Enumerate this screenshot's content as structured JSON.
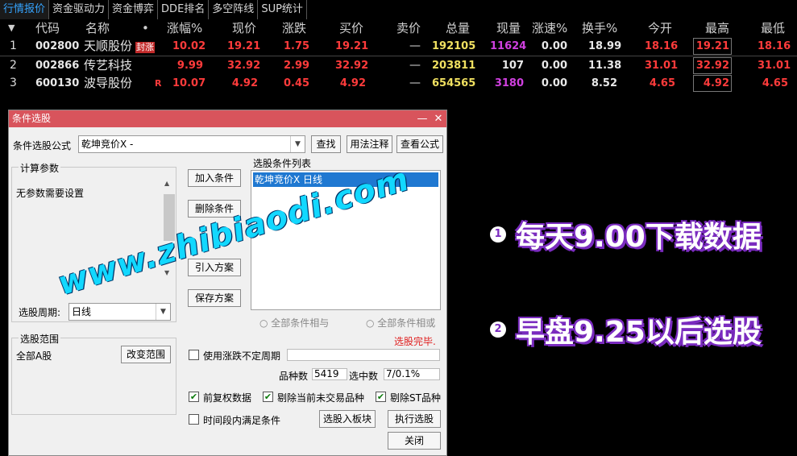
{
  "tabs": [
    "行情报价",
    "资金驱动力",
    "资金博弈",
    "DDE排名",
    "多空阵线",
    "SUP统计"
  ],
  "header": {
    "sort_icon": "▼",
    "cols": [
      "代码",
      "名称",
      "•",
      "涨幅%",
      "现价",
      "涨跌",
      "买价",
      "卖价",
      "总量",
      "现量",
      "涨速%",
      "换手%",
      "今开",
      "最高",
      "最低"
    ]
  },
  "rows": [
    {
      "idx": "1",
      "code": "002800",
      "name": "天顺股份",
      "tag": "封涨",
      "pct": "10.02",
      "price": "19.21",
      "chg": "1.75",
      "bid": "19.21",
      "ask": "—",
      "vol": "192105",
      "cur": "11624",
      "spd": "0.00",
      "turn": "18.99",
      "open": "18.16",
      "high": "19.21",
      "low": "18.16"
    },
    {
      "idx": "2",
      "code": "002866",
      "name": "传艺科技",
      "tag": "",
      "pct": "9.99",
      "price": "32.92",
      "chg": "2.99",
      "bid": "32.92",
      "ask": "—",
      "vol": "203811",
      "cur": "107",
      "spd": "0.00",
      "turn": "11.38",
      "open": "31.01",
      "high": "32.92",
      "low": "31.01"
    },
    {
      "idx": "3",
      "code": "600130",
      "name": "波导股份",
      "tag": "R",
      "pct": "10.07",
      "price": "4.92",
      "chg": "0.45",
      "bid": "4.92",
      "ask": "—",
      "vol": "654565",
      "cur": "3180",
      "spd": "0.00",
      "turn": "8.52",
      "open": "4.65",
      "high": "4.92",
      "low": "4.65"
    }
  ],
  "colors": {
    "up": "#ff3b3b",
    "yellow": "#f0e060",
    "purple": "#d040e0",
    "white": "#e8e8e8",
    "cyan": "#12d8ff"
  },
  "dialog": {
    "title": "条件选股",
    "minimize": "—",
    "close": "✕",
    "formula_label": "条件选股公式",
    "formula_value": "乾坤竞价X  -",
    "find": "查找",
    "usage": "用法注释",
    "view_formula": "查看公式",
    "params_group": "计算参数",
    "no_params": "无参数需要设置",
    "period_label": "选股周期:",
    "period_value": "日线",
    "add_cond": "加入条件",
    "del_cond": "删除条件",
    "import_plan": "引入方案",
    "save_plan": "保存方案",
    "cond_list_label": "选股条件列表",
    "cond_item": "乾坤竞价X  日线",
    "all_and": "全部条件相与",
    "all_or": "全部条件相或",
    "done": "选股完毕.",
    "range_group": "选股范围",
    "range_value": "全部A股",
    "change_range": "改变范围",
    "use_uncertain": "使用涨跌不定周期",
    "count_label": "品种数",
    "count_value": "5419",
    "selected_label": "选中数",
    "selected_value": "7/0.1%",
    "fq": "前复权数据",
    "exclude_untraded": "剔除当前未交易品种",
    "exclude_st": "剔除ST品种",
    "time_range": "时间段内满足条件",
    "to_block": "选股入板块",
    "execute": "执行选股",
    "close_btn": "关闭"
  },
  "watermark": "www.zhibiaodi.com",
  "notes": [
    {
      "num": "1",
      "text": "每天9.00下载数据"
    },
    {
      "num": "2",
      "text": "早盘9.25以后选股"
    }
  ]
}
